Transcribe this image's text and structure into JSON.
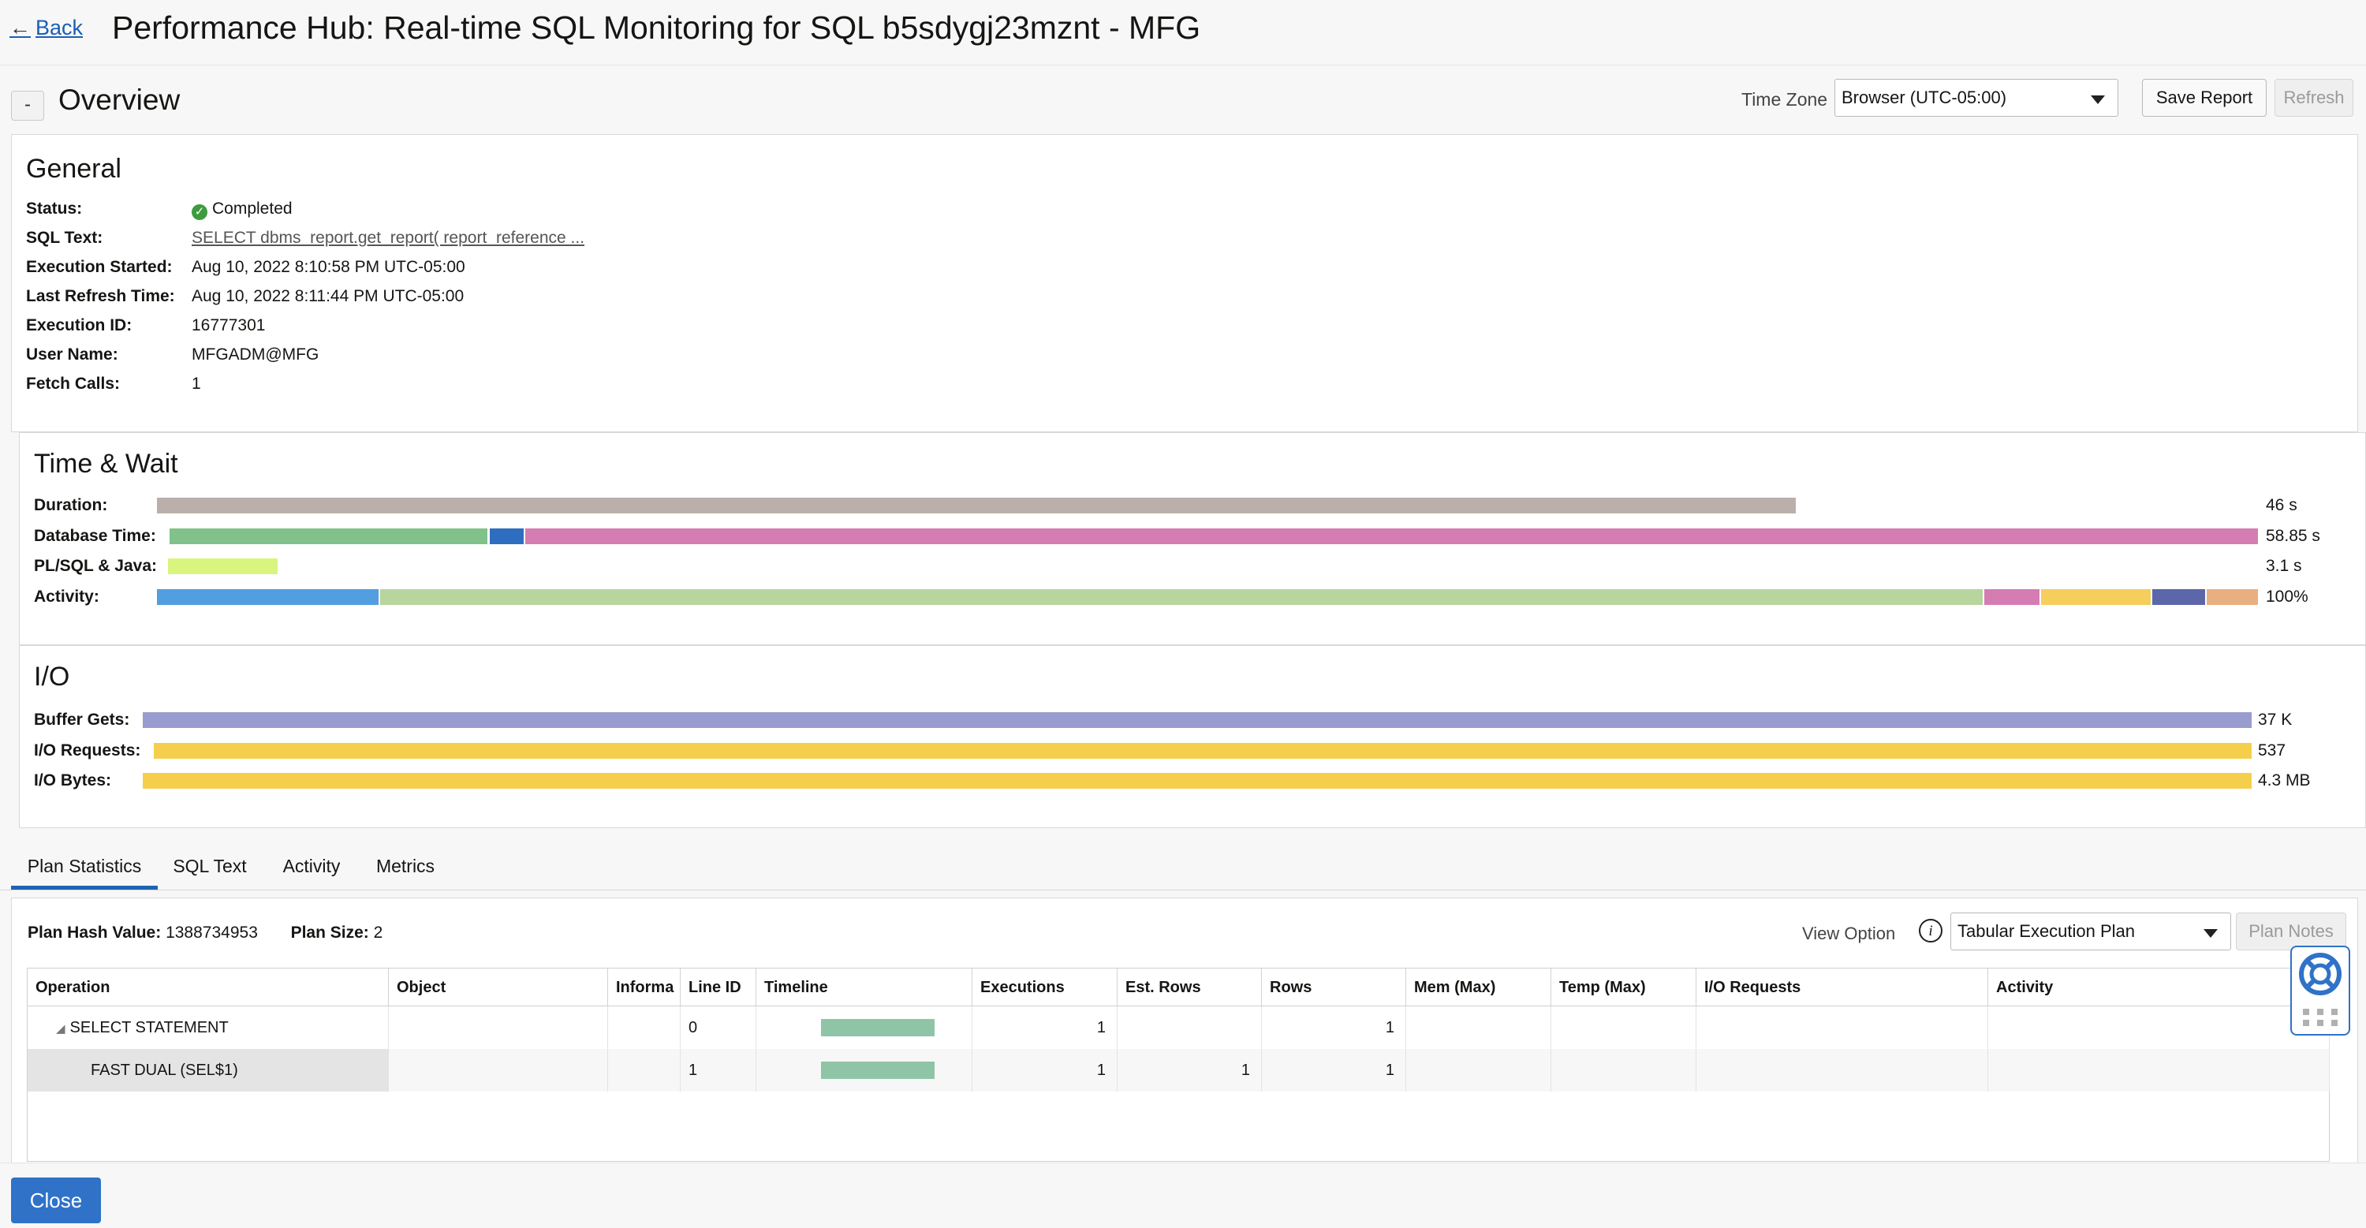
{
  "header": {
    "back_label": "Back",
    "title": "Performance Hub: Real-time SQL Monitoring for SQL b5sdygj23mznt - MFG"
  },
  "overview": {
    "collapse_label": "-",
    "title": "Overview",
    "timezone_label": "Time Zone",
    "timezone_value": "Browser (UTC-05:00)",
    "save_report_label": "Save Report",
    "refresh_label": "Refresh"
  },
  "general": {
    "title": "General",
    "rows": [
      {
        "label": "Status:",
        "value": "Completed"
      },
      {
        "label": "SQL Text:",
        "value": "SELECT dbms_report.get_report( report_reference ..."
      },
      {
        "label": "Execution Started:",
        "value": "Aug 10, 2022 8:10:58 PM UTC-05:00"
      },
      {
        "label": "Last Refresh Time:",
        "value": "Aug 10, 2022 8:11:44 PM UTC-05:00"
      },
      {
        "label": "Execution ID:",
        "value": "16777301"
      },
      {
        "label": "User Name:",
        "value": "MFGADM@MFG"
      },
      {
        "label": "Fetch Calls:",
        "value": "1"
      }
    ]
  },
  "time_wait": {
    "title": "Time & Wait",
    "rows": [
      {
        "label": "Duration:",
        "value": "46 s",
        "fraction": 0.78,
        "segments": [
          {
            "color": "#bbafac",
            "share": 1.0
          }
        ]
      },
      {
        "label": "Database Time:",
        "value": "58.85 s",
        "fraction": 1.0,
        "segments": [
          {
            "color": "#80c28a",
            "share": 0.153
          },
          {
            "color": "#2e6ec0",
            "share": 0.017
          },
          {
            "color": "#d57db2",
            "share": 0.83
          }
        ]
      },
      {
        "label": "PL/SQL & Java:",
        "value": "3.1 s",
        "fraction": 0.053,
        "segments": [
          {
            "color": "#d9f57e",
            "share": 1.0
          }
        ]
      },
      {
        "label": "Activity:",
        "value": "100%",
        "fraction": 1.0,
        "segments": [
          {
            "color": "#529ee0",
            "share": 0.106
          },
          {
            "color": "#b7d59c",
            "share": 0.763
          },
          {
            "color": "#d57db2",
            "share": 0.027
          },
          {
            "color": "#f5ce5c",
            "share": 0.053
          },
          {
            "color": "#5c67a9",
            "share": 0.026
          },
          {
            "color": "#e8b080",
            "share": 0.025
          }
        ]
      }
    ]
  },
  "io": {
    "title": "I/O",
    "rows": [
      {
        "label": "Buffer Gets:",
        "value": "37 K",
        "color": "#999cce",
        "fraction": 1.0
      },
      {
        "label": "I/O Requests:",
        "value": "537",
        "color": "#f5ce4c",
        "fraction": 1.0
      },
      {
        "label": "I/O Bytes:",
        "value": "4.3 MB",
        "color": "#f5ce4c",
        "fraction": 1.0
      }
    ]
  },
  "tabs": [
    "Plan Statistics",
    "SQL Text",
    "Activity",
    "Metrics"
  ],
  "plan": {
    "hash_label": "Plan Hash Value:",
    "hash_value": "1388734953",
    "size_label": "Plan Size:",
    "size_value": "2",
    "view_option_label": "View Option",
    "view_option_value": "Tabular Execution Plan",
    "plan_notes_label": "Plan Notes",
    "columns": [
      "Operation",
      "Object",
      "Informa",
      "Line ID",
      "Timeline",
      "Executions",
      "Est. Rows",
      "Rows",
      "Mem (Max)",
      "Temp (Max)",
      "I/O Requests",
      "Activity"
    ],
    "rows": [
      {
        "operation": "SELECT STATEMENT",
        "object": "",
        "info": "",
        "line_id": "0",
        "timeline": 1.0,
        "executions": "1",
        "est_rows": "",
        "rows": "1",
        "mem": "",
        "temp": "",
        "io_requests": "",
        "activity": ""
      },
      {
        "operation": "FAST DUAL (SEL$1)",
        "object": "",
        "info": "",
        "line_id": "1",
        "timeline": 1.0,
        "executions": "1",
        "est_rows": "1",
        "rows": "1",
        "mem": "",
        "temp": "",
        "io_requests": "",
        "activity": ""
      }
    ]
  },
  "footer": {
    "close_label": "Close"
  }
}
